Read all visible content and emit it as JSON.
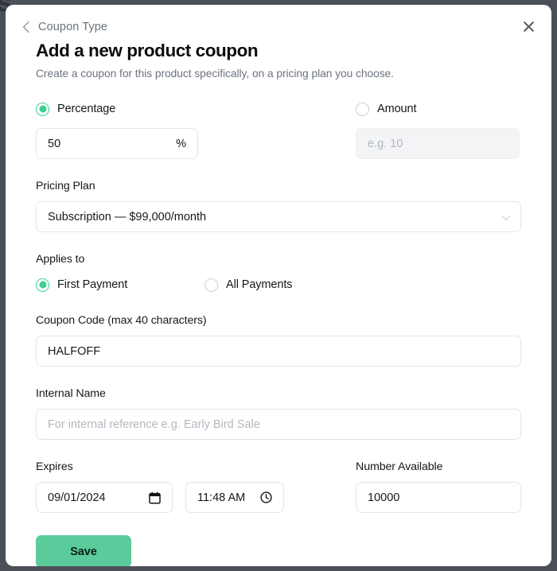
{
  "background": {
    "fragment_text": "s",
    "color": "#4a4f58"
  },
  "modal": {
    "back_link": "Coupon Type",
    "title": "Add a new product coupon",
    "subtitle": "Create a coupon for this product specifically, on a pricing plan you choose.",
    "close_icon": "close-icon"
  },
  "discount_type": {
    "percentage": {
      "label": "Percentage",
      "selected": true,
      "value": "50",
      "suffix": "%"
    },
    "amount": {
      "label": "Amount",
      "selected": false,
      "value": "",
      "placeholder": "e.g. 10"
    }
  },
  "pricing_plan": {
    "label": "Pricing Plan",
    "selected": "Subscription — $99,000/month",
    "chevron_icon": "chevron-down-icon"
  },
  "applies_to": {
    "label": "Applies to",
    "options": [
      {
        "label": "First Payment",
        "selected": true
      },
      {
        "label": "All Payments",
        "selected": false
      }
    ]
  },
  "coupon_code": {
    "label": "Coupon Code (max 40 characters)",
    "value": "HALFOFF"
  },
  "internal_name": {
    "label": "Internal Name",
    "value": "",
    "placeholder": "For internal reference e.g. Early Bird Sale"
  },
  "expires": {
    "label": "Expires",
    "date_value": "09/01/2024",
    "date_icon": "calendar-icon",
    "time_value": "11:48 AM",
    "time_icon": "clock-icon"
  },
  "number_available": {
    "label": "Number Available",
    "value": "10000"
  },
  "actions": {
    "save_label": "Save"
  },
  "colors": {
    "accent_green": "#3ecf8e",
    "save_green": "#5bcb9b",
    "backdrop": "#4a4f58"
  }
}
